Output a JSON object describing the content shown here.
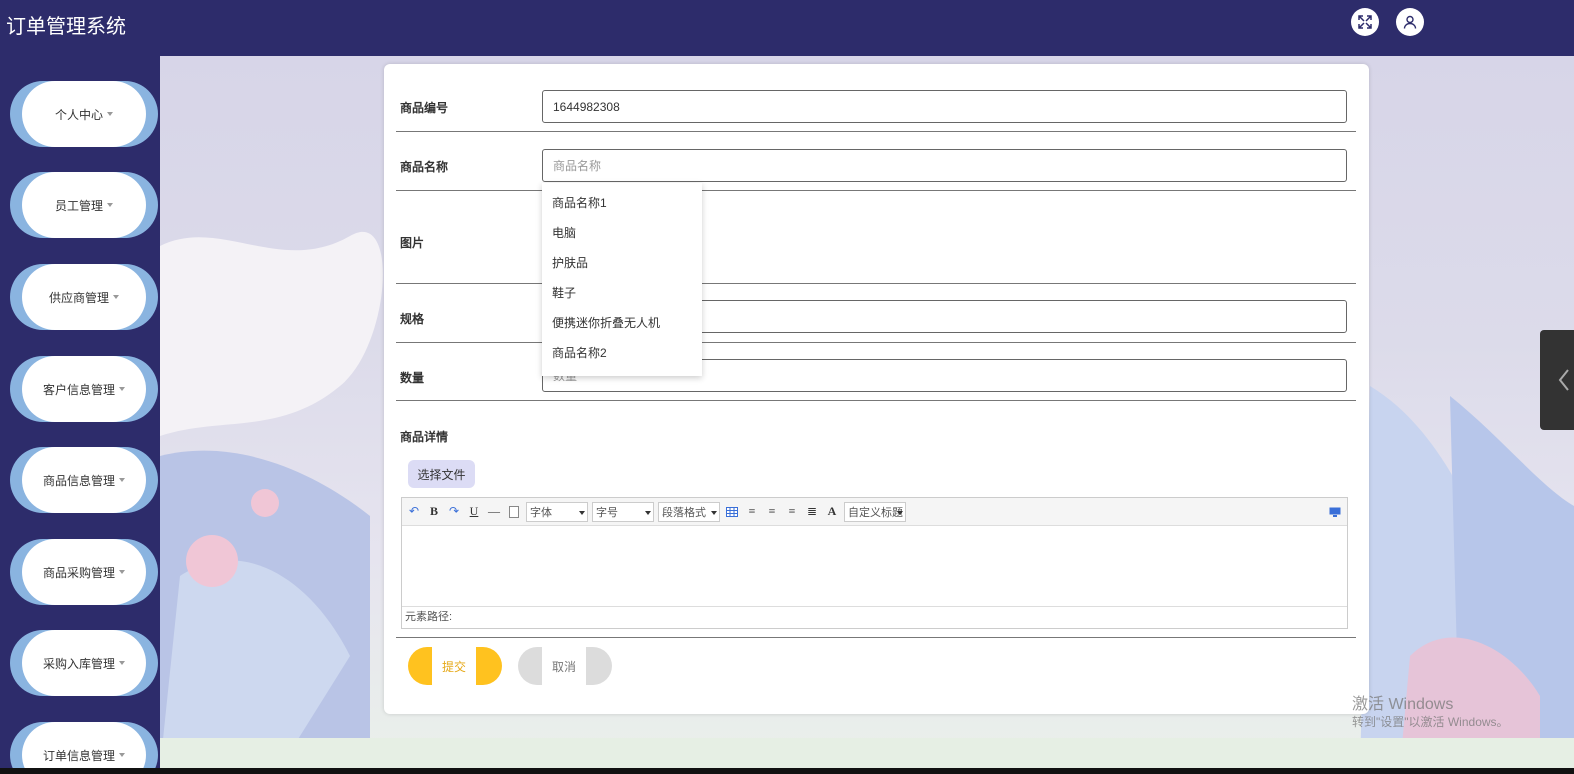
{
  "app": {
    "title": "订单管理系统"
  },
  "header": {
    "icons": [
      "fullscreen-icon",
      "user-icon"
    ]
  },
  "sidebar": {
    "items": [
      {
        "label": "个人中心"
      },
      {
        "label": "员工管理"
      },
      {
        "label": "供应商管理"
      },
      {
        "label": "客户信息管理"
      },
      {
        "label": "商品信息管理"
      },
      {
        "label": "商品采购管理"
      },
      {
        "label": "采购入库管理"
      },
      {
        "label": "订单信息管理"
      }
    ]
  },
  "form": {
    "product_code": {
      "label": "商品编号",
      "value": "1644982308"
    },
    "product_name": {
      "label": "商品名称",
      "placeholder": "商品名称"
    },
    "image": {
      "label": "图片"
    },
    "spec": {
      "label": "规格"
    },
    "quantity": {
      "label": "数量",
      "placeholder": "数量"
    },
    "details": {
      "label": "商品详情"
    },
    "file_button": "选择文件",
    "submit": "提交",
    "cancel": "取消"
  },
  "dropdown": {
    "options": [
      "商品名称1",
      "电脑",
      "护肤品",
      "鞋子",
      "便携迷你折叠无人机",
      "商品名称2"
    ]
  },
  "editor": {
    "font_family": "字体",
    "font_size": "字号",
    "paragraph": "段落格式",
    "custom_title": "自定义标题",
    "element_path": "元素路径:"
  },
  "watermark": {
    "line1": "激活 Windows",
    "line2": "转到\"设置\"以激活 Windows。"
  },
  "colors": {
    "header_bg": "#2d2c6b",
    "submit": "#ffc21f",
    "cancel": "#dcdcdc",
    "menu_accent": "#8ab4e0"
  }
}
